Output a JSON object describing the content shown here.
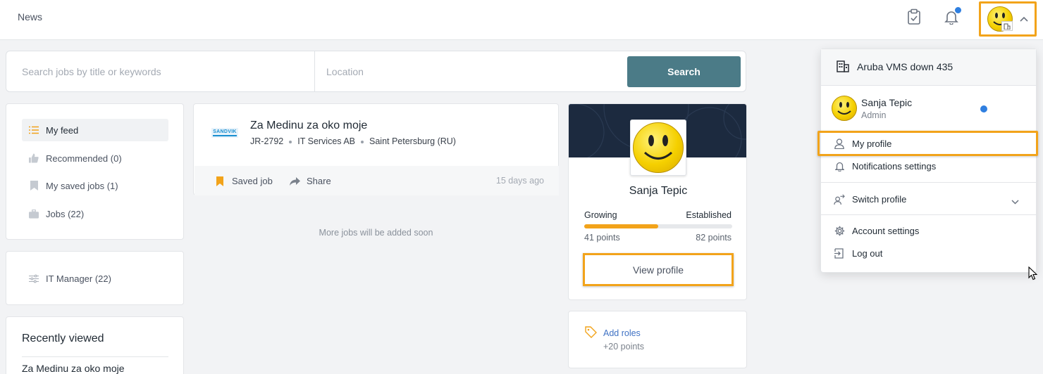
{
  "topbar": {
    "title": "News"
  },
  "search": {
    "keywords_placeholder": "Search jobs by title or keywords",
    "location_placeholder": "Location",
    "button_label": "Search"
  },
  "nav": {
    "items": [
      {
        "label": "My feed",
        "icon": "list-icon",
        "active": true
      },
      {
        "label": "Recommended (0)",
        "icon": "thumbs-up-icon"
      },
      {
        "label": "My saved jobs (1)",
        "icon": "bookmark-icon"
      },
      {
        "label": "Jobs (22)",
        "icon": "briefcase-icon"
      }
    ]
  },
  "filter": {
    "label": "IT Manager (22)"
  },
  "recent": {
    "title": "Recently viewed",
    "items": [
      "Za Medinu za oko moje"
    ]
  },
  "job": {
    "company_logo_text": "SANDVIK",
    "title": "Za Medinu za oko moje",
    "id": "JR-2792",
    "company": "IT Services AB",
    "location": "Saint Petersburg (RU)",
    "saved_label": "Saved job",
    "share_label": "Share",
    "posted": "15 days ago"
  },
  "more_jobs_text": "More jobs will be added soon",
  "profile": {
    "name": "Sanja Tepic",
    "level_current": "Growing",
    "level_next": "Established",
    "points_current": "41 points",
    "points_next": "82 points",
    "progress_fraction": 0.5,
    "view_button": "View profile"
  },
  "roles": {
    "link": "Add roles",
    "points": "+20 points"
  },
  "dropdown": {
    "org_name": "Aruba VMS down 435",
    "user_name": "Sanja Tepic",
    "user_role": "Admin",
    "my_profile": "My profile",
    "notifications": "Notifications settings",
    "switch_profile": "Switch profile",
    "account_settings": "Account settings",
    "logout": "Log out"
  },
  "colors": {
    "accent": "#f2a31a",
    "search_button": "#4b7b87",
    "banner": "#1c2a3f",
    "link": "#3f72c4",
    "status_dot": "#2f7fe0"
  }
}
